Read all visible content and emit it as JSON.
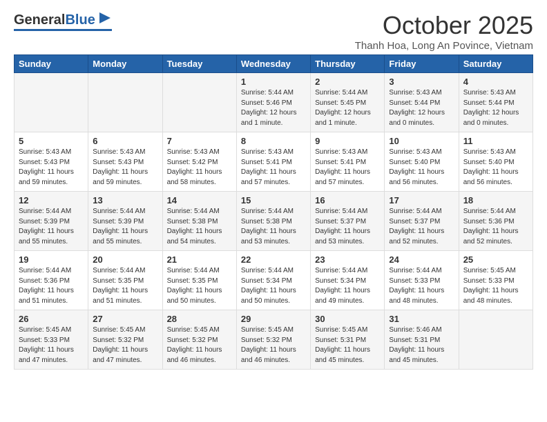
{
  "logo": {
    "general": "General",
    "blue": "Blue"
  },
  "header": {
    "month": "October 2025",
    "subtitle": "Thanh Hoa, Long An Povince, Vietnam"
  },
  "weekdays": [
    "Sunday",
    "Monday",
    "Tuesday",
    "Wednesday",
    "Thursday",
    "Friday",
    "Saturday"
  ],
  "weeks": [
    [
      {
        "day": "",
        "info": ""
      },
      {
        "day": "",
        "info": ""
      },
      {
        "day": "",
        "info": ""
      },
      {
        "day": "1",
        "info": "Sunrise: 5:44 AM\nSunset: 5:46 PM\nDaylight: 12 hours\nand 1 minute."
      },
      {
        "day": "2",
        "info": "Sunrise: 5:44 AM\nSunset: 5:45 PM\nDaylight: 12 hours\nand 1 minute."
      },
      {
        "day": "3",
        "info": "Sunrise: 5:43 AM\nSunset: 5:44 PM\nDaylight: 12 hours\nand 0 minutes."
      },
      {
        "day": "4",
        "info": "Sunrise: 5:43 AM\nSunset: 5:44 PM\nDaylight: 12 hours\nand 0 minutes."
      }
    ],
    [
      {
        "day": "5",
        "info": "Sunrise: 5:43 AM\nSunset: 5:43 PM\nDaylight: 11 hours\nand 59 minutes."
      },
      {
        "day": "6",
        "info": "Sunrise: 5:43 AM\nSunset: 5:43 PM\nDaylight: 11 hours\nand 59 minutes."
      },
      {
        "day": "7",
        "info": "Sunrise: 5:43 AM\nSunset: 5:42 PM\nDaylight: 11 hours\nand 58 minutes."
      },
      {
        "day": "8",
        "info": "Sunrise: 5:43 AM\nSunset: 5:41 PM\nDaylight: 11 hours\nand 57 minutes."
      },
      {
        "day": "9",
        "info": "Sunrise: 5:43 AM\nSunset: 5:41 PM\nDaylight: 11 hours\nand 57 minutes."
      },
      {
        "day": "10",
        "info": "Sunrise: 5:43 AM\nSunset: 5:40 PM\nDaylight: 11 hours\nand 56 minutes."
      },
      {
        "day": "11",
        "info": "Sunrise: 5:43 AM\nSunset: 5:40 PM\nDaylight: 11 hours\nand 56 minutes."
      }
    ],
    [
      {
        "day": "12",
        "info": "Sunrise: 5:44 AM\nSunset: 5:39 PM\nDaylight: 11 hours\nand 55 minutes."
      },
      {
        "day": "13",
        "info": "Sunrise: 5:44 AM\nSunset: 5:39 PM\nDaylight: 11 hours\nand 55 minutes."
      },
      {
        "day": "14",
        "info": "Sunrise: 5:44 AM\nSunset: 5:38 PM\nDaylight: 11 hours\nand 54 minutes."
      },
      {
        "day": "15",
        "info": "Sunrise: 5:44 AM\nSunset: 5:38 PM\nDaylight: 11 hours\nand 53 minutes."
      },
      {
        "day": "16",
        "info": "Sunrise: 5:44 AM\nSunset: 5:37 PM\nDaylight: 11 hours\nand 53 minutes."
      },
      {
        "day": "17",
        "info": "Sunrise: 5:44 AM\nSunset: 5:37 PM\nDaylight: 11 hours\nand 52 minutes."
      },
      {
        "day": "18",
        "info": "Sunrise: 5:44 AM\nSunset: 5:36 PM\nDaylight: 11 hours\nand 52 minutes."
      }
    ],
    [
      {
        "day": "19",
        "info": "Sunrise: 5:44 AM\nSunset: 5:36 PM\nDaylight: 11 hours\nand 51 minutes."
      },
      {
        "day": "20",
        "info": "Sunrise: 5:44 AM\nSunset: 5:35 PM\nDaylight: 11 hours\nand 51 minutes."
      },
      {
        "day": "21",
        "info": "Sunrise: 5:44 AM\nSunset: 5:35 PM\nDaylight: 11 hours\nand 50 minutes."
      },
      {
        "day": "22",
        "info": "Sunrise: 5:44 AM\nSunset: 5:34 PM\nDaylight: 11 hours\nand 50 minutes."
      },
      {
        "day": "23",
        "info": "Sunrise: 5:44 AM\nSunset: 5:34 PM\nDaylight: 11 hours\nand 49 minutes."
      },
      {
        "day": "24",
        "info": "Sunrise: 5:44 AM\nSunset: 5:33 PM\nDaylight: 11 hours\nand 48 minutes."
      },
      {
        "day": "25",
        "info": "Sunrise: 5:45 AM\nSunset: 5:33 PM\nDaylight: 11 hours\nand 48 minutes."
      }
    ],
    [
      {
        "day": "26",
        "info": "Sunrise: 5:45 AM\nSunset: 5:33 PM\nDaylight: 11 hours\nand 47 minutes."
      },
      {
        "day": "27",
        "info": "Sunrise: 5:45 AM\nSunset: 5:32 PM\nDaylight: 11 hours\nand 47 minutes."
      },
      {
        "day": "28",
        "info": "Sunrise: 5:45 AM\nSunset: 5:32 PM\nDaylight: 11 hours\nand 46 minutes."
      },
      {
        "day": "29",
        "info": "Sunrise: 5:45 AM\nSunset: 5:32 PM\nDaylight: 11 hours\nand 46 minutes."
      },
      {
        "day": "30",
        "info": "Sunrise: 5:45 AM\nSunset: 5:31 PM\nDaylight: 11 hours\nand 45 minutes."
      },
      {
        "day": "31",
        "info": "Sunrise: 5:46 AM\nSunset: 5:31 PM\nDaylight: 11 hours\nand 45 minutes."
      },
      {
        "day": "",
        "info": ""
      }
    ]
  ]
}
